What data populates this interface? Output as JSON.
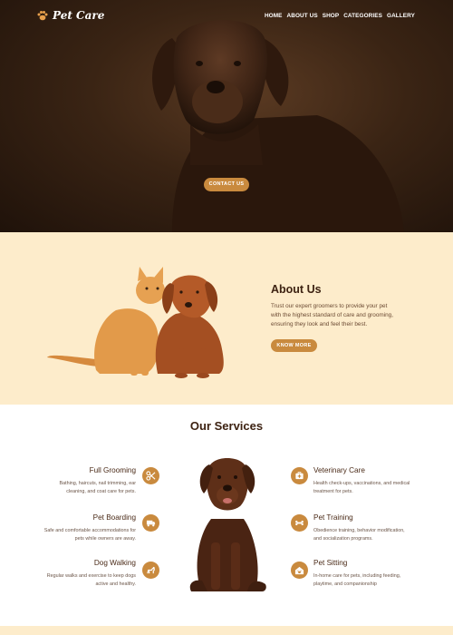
{
  "brand": {
    "name": "Pet Care",
    "accent": "#c98a3e",
    "cream": "#fdeccb"
  },
  "nav": {
    "items": [
      {
        "label": "HOME"
      },
      {
        "label": "ABOUT US"
      },
      {
        "label": "SHOP"
      },
      {
        "label": "CATEGORIES"
      },
      {
        "label": "GALLERY"
      }
    ]
  },
  "hero": {
    "button_label": "CONTACT US"
  },
  "about": {
    "title": "About Us",
    "text": "Trust our expert groomers to provide your pet with the highest standard of care and grooming, ensuring they look and feel their best.",
    "button_label": "KNOW MORE"
  },
  "services": {
    "title": "Our Services",
    "items": [
      {
        "title": "Full Grooming",
        "desc": "Bathing, haircuts, nail trimming, ear cleaning, and coat care for pets.",
        "icon": "scissors-icon"
      },
      {
        "title": "Pet Boarding",
        "desc": "Safe and comfortable accommodations for pets while owners are away.",
        "icon": "truck-icon"
      },
      {
        "title": "Dog Walking",
        "desc": "Regular walks and exercise to keep dogs active and healthy.",
        "icon": "dog-walk-icon"
      },
      {
        "title": "Veterinary Care",
        "desc": "Health check-ups, vaccinations, and medical treatment for pets.",
        "icon": "first-aid-icon"
      },
      {
        "title": "Pet Training",
        "desc": "Obedience training, behavior modification, and socialization programs.",
        "icon": "bone-icon"
      },
      {
        "title": "Pet Sitting",
        "desc": "In-home care for pets, including feeding, playtime, and companionship",
        "icon": "pet-sitting-icon"
      }
    ]
  }
}
